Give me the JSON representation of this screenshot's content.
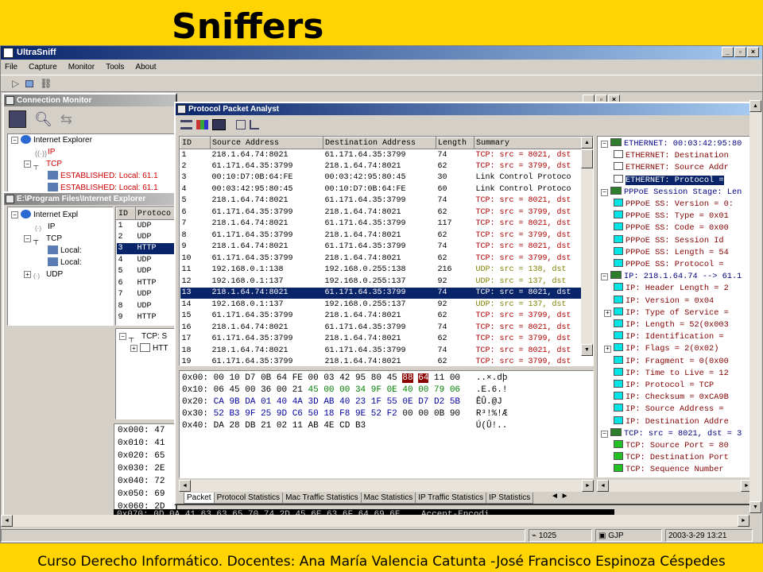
{
  "slide": {
    "title": "Sniffers",
    "footer": "Curso Derecho Informático. Docentes: Ana María Valencia Catunta -José Francisco Espinoza Céspedes"
  },
  "app": {
    "title": "UltraSniff",
    "window_buttons": [
      "_",
      "▫",
      "×"
    ],
    "menu": [
      "File",
      "Capture",
      "Monitor",
      "Tools",
      "About"
    ]
  },
  "connection_monitor": {
    "title": "Connection Monitor",
    "tree": [
      {
        "label": "Internet Explorer",
        "level": 0
      },
      {
        "label": "IP",
        "level": 1
      },
      {
        "label": "TCP",
        "level": 1
      },
      {
        "label": "ESTABLISHED: Local: 61.1",
        "level": 2
      },
      {
        "label": "ESTABLISHED: Local: 61.1",
        "level": 2
      }
    ]
  },
  "ie_window": {
    "title": "E:\\Program Files\\Internet Explorer",
    "tree": [
      {
        "label": "Internet Expl",
        "level": 0
      },
      {
        "label": "IP",
        "level": 1
      },
      {
        "label": "TCP",
        "level": 1
      },
      {
        "label": "Local:",
        "level": 2
      },
      {
        "label": "Local:",
        "level": 2
      },
      {
        "label": "UDP",
        "level": 1
      }
    ],
    "list_header": [
      "ID",
      "Protoco"
    ],
    "list": [
      {
        "id": "1",
        "proto": "UDP"
      },
      {
        "id": "2",
        "proto": "UDP"
      },
      {
        "id": "3",
        "proto": "HTTP"
      },
      {
        "id": "4",
        "proto": "UDP"
      },
      {
        "id": "5",
        "proto": "UDP"
      },
      {
        "id": "6",
        "proto": "HTTP"
      },
      {
        "id": "7",
        "proto": "UDP"
      },
      {
        "id": "8",
        "proto": "UDP"
      },
      {
        "id": "9",
        "proto": "HTTP"
      }
    ],
    "subtree": [
      "TCP: S",
      "HTT"
    ],
    "hex_offsets": [
      "0x000:",
      "0x010:",
      "0x020:",
      "0x030:",
      "0x040:",
      "0x050:",
      "0x060:",
      "0x070:"
    ],
    "hex_frag": [
      "47",
      "41",
      "65",
      "2E",
      "72",
      "69",
      "2D",
      "0D 0A 41 63 63 65 70 74 2D 45 6E 63 6F 64 69 6E"
    ],
    "ascii_frag": "Accept-Encodi"
  },
  "packet_analyst": {
    "title": "Protocol Packet Analyst",
    "columns": [
      "ID",
      "Source Address",
      "Destination Address",
      "Length",
      "Summary"
    ],
    "rows": [
      {
        "id": "1",
        "src": "218.1.64.74:8021",
        "dst": "61.171.64.35:3799",
        "len": "74",
        "sum": "TCP: src = 8021, dst",
        "kind": "tcp"
      },
      {
        "id": "2",
        "src": "61.171.64.35:3799",
        "dst": "218.1.64.74:8021",
        "len": "62",
        "sum": "TCP: src = 3799, dst",
        "kind": "tcp"
      },
      {
        "id": "3",
        "src": "00:10:D7:0B:64:FE",
        "dst": "00:03:42:95:80:45",
        "len": "30",
        "sum": "Link Control Protoco",
        "kind": "other"
      },
      {
        "id": "4",
        "src": "00:03:42:95:80:45",
        "dst": "00:10:D7:0B:64:FE",
        "len": "60",
        "sum": "Link Control Protoco",
        "kind": "other"
      },
      {
        "id": "5",
        "src": "218.1.64.74:8021",
        "dst": "61.171.64.35:3799",
        "len": "74",
        "sum": "TCP: src = 8021, dst",
        "kind": "tcp"
      },
      {
        "id": "6",
        "src": "61.171.64.35:3799",
        "dst": "218.1.64.74:8021",
        "len": "62",
        "sum": "TCP: src = 3799, dst",
        "kind": "tcp"
      },
      {
        "id": "7",
        "src": "218.1.64.74:8021",
        "dst": "61.171.64.35:3799",
        "len": "117",
        "sum": "TCP: src = 8021, dst",
        "kind": "tcp"
      },
      {
        "id": "8",
        "src": "61.171.64.35:3799",
        "dst": "218.1.64.74:8021",
        "len": "62",
        "sum": "TCP: src = 3799, dst",
        "kind": "tcp"
      },
      {
        "id": "9",
        "src": "218.1.64.74:8021",
        "dst": "61.171.64.35:3799",
        "len": "74",
        "sum": "TCP: src = 8021, dst",
        "kind": "tcp"
      },
      {
        "id": "10",
        "src": "61.171.64.35:3799",
        "dst": "218.1.64.74:8021",
        "len": "62",
        "sum": "TCP: src = 3799, dst",
        "kind": "tcp"
      },
      {
        "id": "11",
        "src": "192.168.0.1:138",
        "dst": "192.168.0.255:138",
        "len": "216",
        "sum": "UDP: src = 138, dst",
        "kind": "udp"
      },
      {
        "id": "12",
        "src": "192.168.0.1:137",
        "dst": "192.168.0.255:137",
        "len": "92",
        "sum": "UDP: src = 137, dst",
        "kind": "udp"
      },
      {
        "id": "13",
        "src": "218.1.64.74:8021",
        "dst": "61.171.64.35:3799",
        "len": "74",
        "sum": "TCP: src = 8021, dst",
        "kind": "sel"
      },
      {
        "id": "14",
        "src": "192.168.0.1:137",
        "dst": "192.168.0.255:137",
        "len": "92",
        "sum": "UDP: src = 137, dst",
        "kind": "udp"
      },
      {
        "id": "15",
        "src": "61.171.64.35:3799",
        "dst": "218.1.64.74:8021",
        "len": "62",
        "sum": "TCP: src = 3799, dst",
        "kind": "tcp"
      },
      {
        "id": "16",
        "src": "218.1.64.74:8021",
        "dst": "61.171.64.35:3799",
        "len": "74",
        "sum": "TCP: src = 8021, dst",
        "kind": "tcp"
      },
      {
        "id": "17",
        "src": "61.171.64.35:3799",
        "dst": "218.1.64.74:8021",
        "len": "62",
        "sum": "TCP: src = 3799, dst",
        "kind": "tcp"
      },
      {
        "id": "18",
        "src": "218.1.64.74:8021",
        "dst": "61.171.64.35:3799",
        "len": "74",
        "sum": "TCP: src = 8021, dst",
        "kind": "tcp"
      },
      {
        "id": "19",
        "src": "61.171.64.35:3799",
        "dst": "218.1.64.74:8021",
        "len": "62",
        "sum": "TCP: src = 3799, dst",
        "kind": "tcp"
      }
    ],
    "hex": [
      {
        "off": "0x00:",
        "bytes": [
          "00",
          "10",
          "D7",
          "0B",
          "64",
          "FE",
          "00",
          "03",
          "42",
          "95",
          "80",
          "45",
          "88",
          "64",
          "11",
          "00"
        ],
        "ascii": "..×.dþ"
      },
      {
        "off": "0x10:",
        "bytes": [
          "06",
          "45",
          "00",
          "36",
          "00",
          "21",
          "45",
          "00",
          "00",
          "34",
          "9F",
          "0E",
          "40",
          "00",
          "79",
          "06"
        ],
        "ascii": ".E.6.!"
      },
      {
        "off": "0x20:",
        "bytes": [
          "CA",
          "9B",
          "DA",
          "01",
          "40",
          "4A",
          "3D",
          "AB",
          "40",
          "23",
          "1F",
          "55",
          "0E",
          "D7",
          "D2",
          "5B"
        ],
        "ascii": "ÊÛ.@J"
      },
      {
        "off": "0x30:",
        "bytes": [
          "52",
          "B3",
          "9F",
          "25",
          "9D",
          "C6",
          "50",
          "18",
          "F8",
          "9E",
          "52",
          "F2",
          "00",
          "00",
          "0B",
          "90"
        ],
        "ascii": "R³!%!Æ"
      },
      {
        "off": "0x40:",
        "bytes": [
          "DA",
          "28",
          "DB",
          "21",
          "02",
          "11",
          "AB",
          "4E",
          "CD",
          "B3"
        ],
        "ascii": "Ú(Û!.."
      }
    ],
    "tabs": [
      "Packet",
      "Protocol Statistics",
      "Mac Traffic Statistics",
      "Mac Statistics",
      "IP Traffic Statistics",
      "IP Statistics"
    ],
    "details": [
      {
        "t": "ETHERNET: 00:03:42:95:80",
        "icon": "sec",
        "lvl": 0
      },
      {
        "t": "ETHERNET: Destination",
        "icon": "w",
        "lvl": 1
      },
      {
        "t": "ETHERNET: Source Addr",
        "icon": "w",
        "lvl": 1
      },
      {
        "t": "ETHERNET: Protocol =",
        "icon": "w",
        "lvl": 1,
        "sel": true
      },
      {
        "t": "PPPoE Session Stage: Len",
        "icon": "sec",
        "lvl": 0
      },
      {
        "t": "PPPoE SS: Version = 0:",
        "icon": "c",
        "lvl": 1
      },
      {
        "t": "PPPoE SS: Type = 0x01",
        "icon": "c",
        "lvl": 1
      },
      {
        "t": "PPPoE SS: Code = 0x00",
        "icon": "c",
        "lvl": 1
      },
      {
        "t": "PPPoE SS: Session Id",
        "icon": "c",
        "lvl": 1
      },
      {
        "t": "PPPoE SS: Length = 54",
        "icon": "c",
        "lvl": 1
      },
      {
        "t": "PPPoE SS: Protocol =",
        "icon": "c",
        "lvl": 1
      },
      {
        "t": "IP: 218.1.64.74 --> 61.1",
        "icon": "sec",
        "lvl": 0
      },
      {
        "t": "IP: Header Length = 2",
        "icon": "c",
        "lvl": 1
      },
      {
        "t": "IP: Version = 0x04",
        "icon": "c",
        "lvl": 1
      },
      {
        "t": "IP: Type of Service =",
        "icon": "c",
        "lvl": 1,
        "exp": true
      },
      {
        "t": "IP: Length = 52(0x003",
        "icon": "c",
        "lvl": 1
      },
      {
        "t": "IP: Identification =",
        "icon": "c",
        "lvl": 1
      },
      {
        "t": "IP: Flags = 2(0x02)",
        "icon": "c",
        "lvl": 1,
        "exp": true
      },
      {
        "t": "IP: Fragment = 0(0x00",
        "icon": "c",
        "lvl": 1
      },
      {
        "t": "IP: Time to Live = 12",
        "icon": "c",
        "lvl": 1
      },
      {
        "t": "IP: Protocol = TCP",
        "icon": "c",
        "lvl": 1
      },
      {
        "t": "IP: Checksum = 0xCA9B",
        "icon": "c",
        "lvl": 1
      },
      {
        "t": "IP: Source Address =",
        "icon": "c",
        "lvl": 1
      },
      {
        "t": "IP: Destination Addre",
        "icon": "c",
        "lvl": 1
      },
      {
        "t": "TCP: src = 8021, dst = 3",
        "icon": "sec",
        "lvl": 0
      },
      {
        "t": "TCP: Source Port = 80",
        "icon": "g",
        "lvl": 1
      },
      {
        "t": "TCP: Destination Port",
        "icon": "g",
        "lvl": 1
      },
      {
        "t": "TCP: Sequence Number",
        "icon": "g",
        "lvl": 1
      }
    ]
  },
  "statusbar": {
    "count": "1025",
    "zone": "GJP",
    "datetime": "2003-3-29 13:21"
  }
}
